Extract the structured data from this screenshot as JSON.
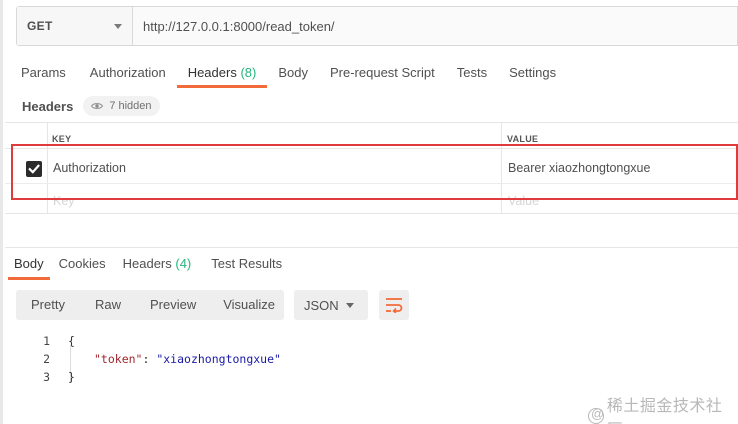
{
  "request": {
    "method": "GET",
    "url": "http://127.0.0.1:8000/read_token/"
  },
  "req_tabs": [
    {
      "label": "Params"
    },
    {
      "label": "Authorization"
    },
    {
      "label": "Headers",
      "count": "(8)"
    },
    {
      "label": "Body"
    },
    {
      "label": "Pre-request Script"
    },
    {
      "label": "Tests"
    },
    {
      "label": "Settings"
    }
  ],
  "headers_section": {
    "title": "Headers",
    "hidden_label": "7 hidden"
  },
  "table": {
    "col_key": "KEY",
    "col_value": "VALUE",
    "rows": [
      {
        "key": "Authorization",
        "value": "Bearer xiaozhongtongxue",
        "checked": true
      }
    ],
    "placeholder_key": "Key",
    "placeholder_value": "Value"
  },
  "resp_tabs": [
    {
      "label": "Body"
    },
    {
      "label": "Cookies"
    },
    {
      "label": "Headers",
      "count": "(4)"
    },
    {
      "label": "Test Results"
    }
  ],
  "response_toolbar": {
    "views": [
      "Pretty",
      "Raw",
      "Preview",
      "Visualize"
    ],
    "format": "JSON"
  },
  "response_body": {
    "line_numbers": [
      "1",
      "2",
      "3"
    ],
    "open_brace": "{",
    "key": "\"token\"",
    "colon": ": ",
    "value": "\"xiaozhongtongxue\"",
    "close_brace": "}"
  },
  "watermark": "稀土掘金技术社区",
  "colors": {
    "accent": "#f26b3a",
    "count_green": "#26b47f",
    "highlight_red": "#e03a3a"
  }
}
